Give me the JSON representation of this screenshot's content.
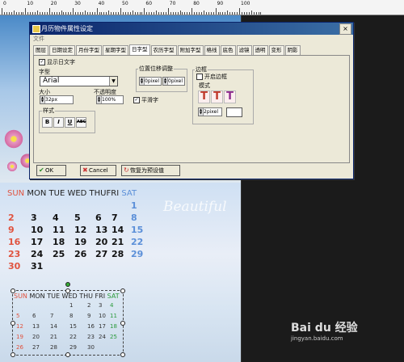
{
  "ruler": {
    "labels": [
      "0",
      "10",
      "20",
      "30",
      "40",
      "50",
      "60",
      "70",
      "80",
      "90",
      "100"
    ]
  },
  "calendar": {
    "weekdays": [
      "SUN",
      "MON",
      "TUE",
      "WED",
      "THU",
      "FRI",
      "SAT"
    ],
    "month_tag": "",
    "watermark_word": "Beautiful",
    "rows": [
      [
        "",
        "",
        "",
        "",
        "",
        "",
        "1"
      ],
      [
        "2",
        "3",
        "4",
        "5",
        "6",
        "7",
        "8"
      ],
      [
        "9",
        "10",
        "11",
        "12",
        "13",
        "14",
        "15"
      ],
      [
        "16",
        "17",
        "18",
        "19",
        "20",
        "21",
        "22"
      ],
      [
        "23",
        "24",
        "25",
        "26",
        "27",
        "28",
        "29"
      ],
      [
        "30",
        "31",
        "",
        "",
        "",
        "",
        ""
      ]
    ],
    "small_rows": [
      [
        "",
        "",
        "",
        "1",
        "2",
        "3",
        "4"
      ],
      [
        "5",
        "6",
        "7",
        "8",
        "9",
        "10",
        "11"
      ],
      [
        "12",
        "13",
        "14",
        "15",
        "16",
        "17",
        "18"
      ],
      [
        "19",
        "20",
        "21",
        "22",
        "23",
        "24",
        "25"
      ],
      [
        "26",
        "27",
        "28",
        "29",
        "30",
        "",
        ""
      ]
    ]
  },
  "dialog": {
    "title": "月历物件属性设定",
    "menu": "文件",
    "close_label": "×",
    "tabs": [
      "图层",
      "日期设定",
      "月份字型",
      "星期字型",
      "日字型",
      "农历字型",
      "附加字型",
      "格线",
      "底色",
      "滤镜",
      "透明",
      "变形",
      "阴影"
    ],
    "active_tab": 4,
    "show_day_text": "显示日文字",
    "font_label": "字型",
    "font_value": "Arial",
    "size_label": "大小",
    "size_value": "32",
    "size_unit": "px",
    "opacity_label": "不透明度",
    "opacity_value": "100",
    "opacity_unit": "%",
    "style_label": "样式",
    "style_buttons": [
      "B",
      "I",
      "U",
      "ABC"
    ],
    "offset_label": "位置位移调整",
    "offset_x": "0",
    "offset_y": "0",
    "offset_unit": "pixel",
    "smooth_label": "平滑字",
    "border_label": "边框",
    "border_enable": "开启边框",
    "border_mode": "模式",
    "border_width": "2",
    "border_unit": "pixel",
    "ok_label": "OK",
    "cancel_label": "Cancel",
    "reset_label": "恢复为预设值"
  },
  "watermark": {
    "brand": "Bai du 经验",
    "sub": "jingyan.baidu.com"
  },
  "colors": {
    "sun": "#e0533f",
    "sat": "#5b8fd8",
    "dialog_bg": "#ece9d8",
    "title_bar": "#0a246a"
  }
}
